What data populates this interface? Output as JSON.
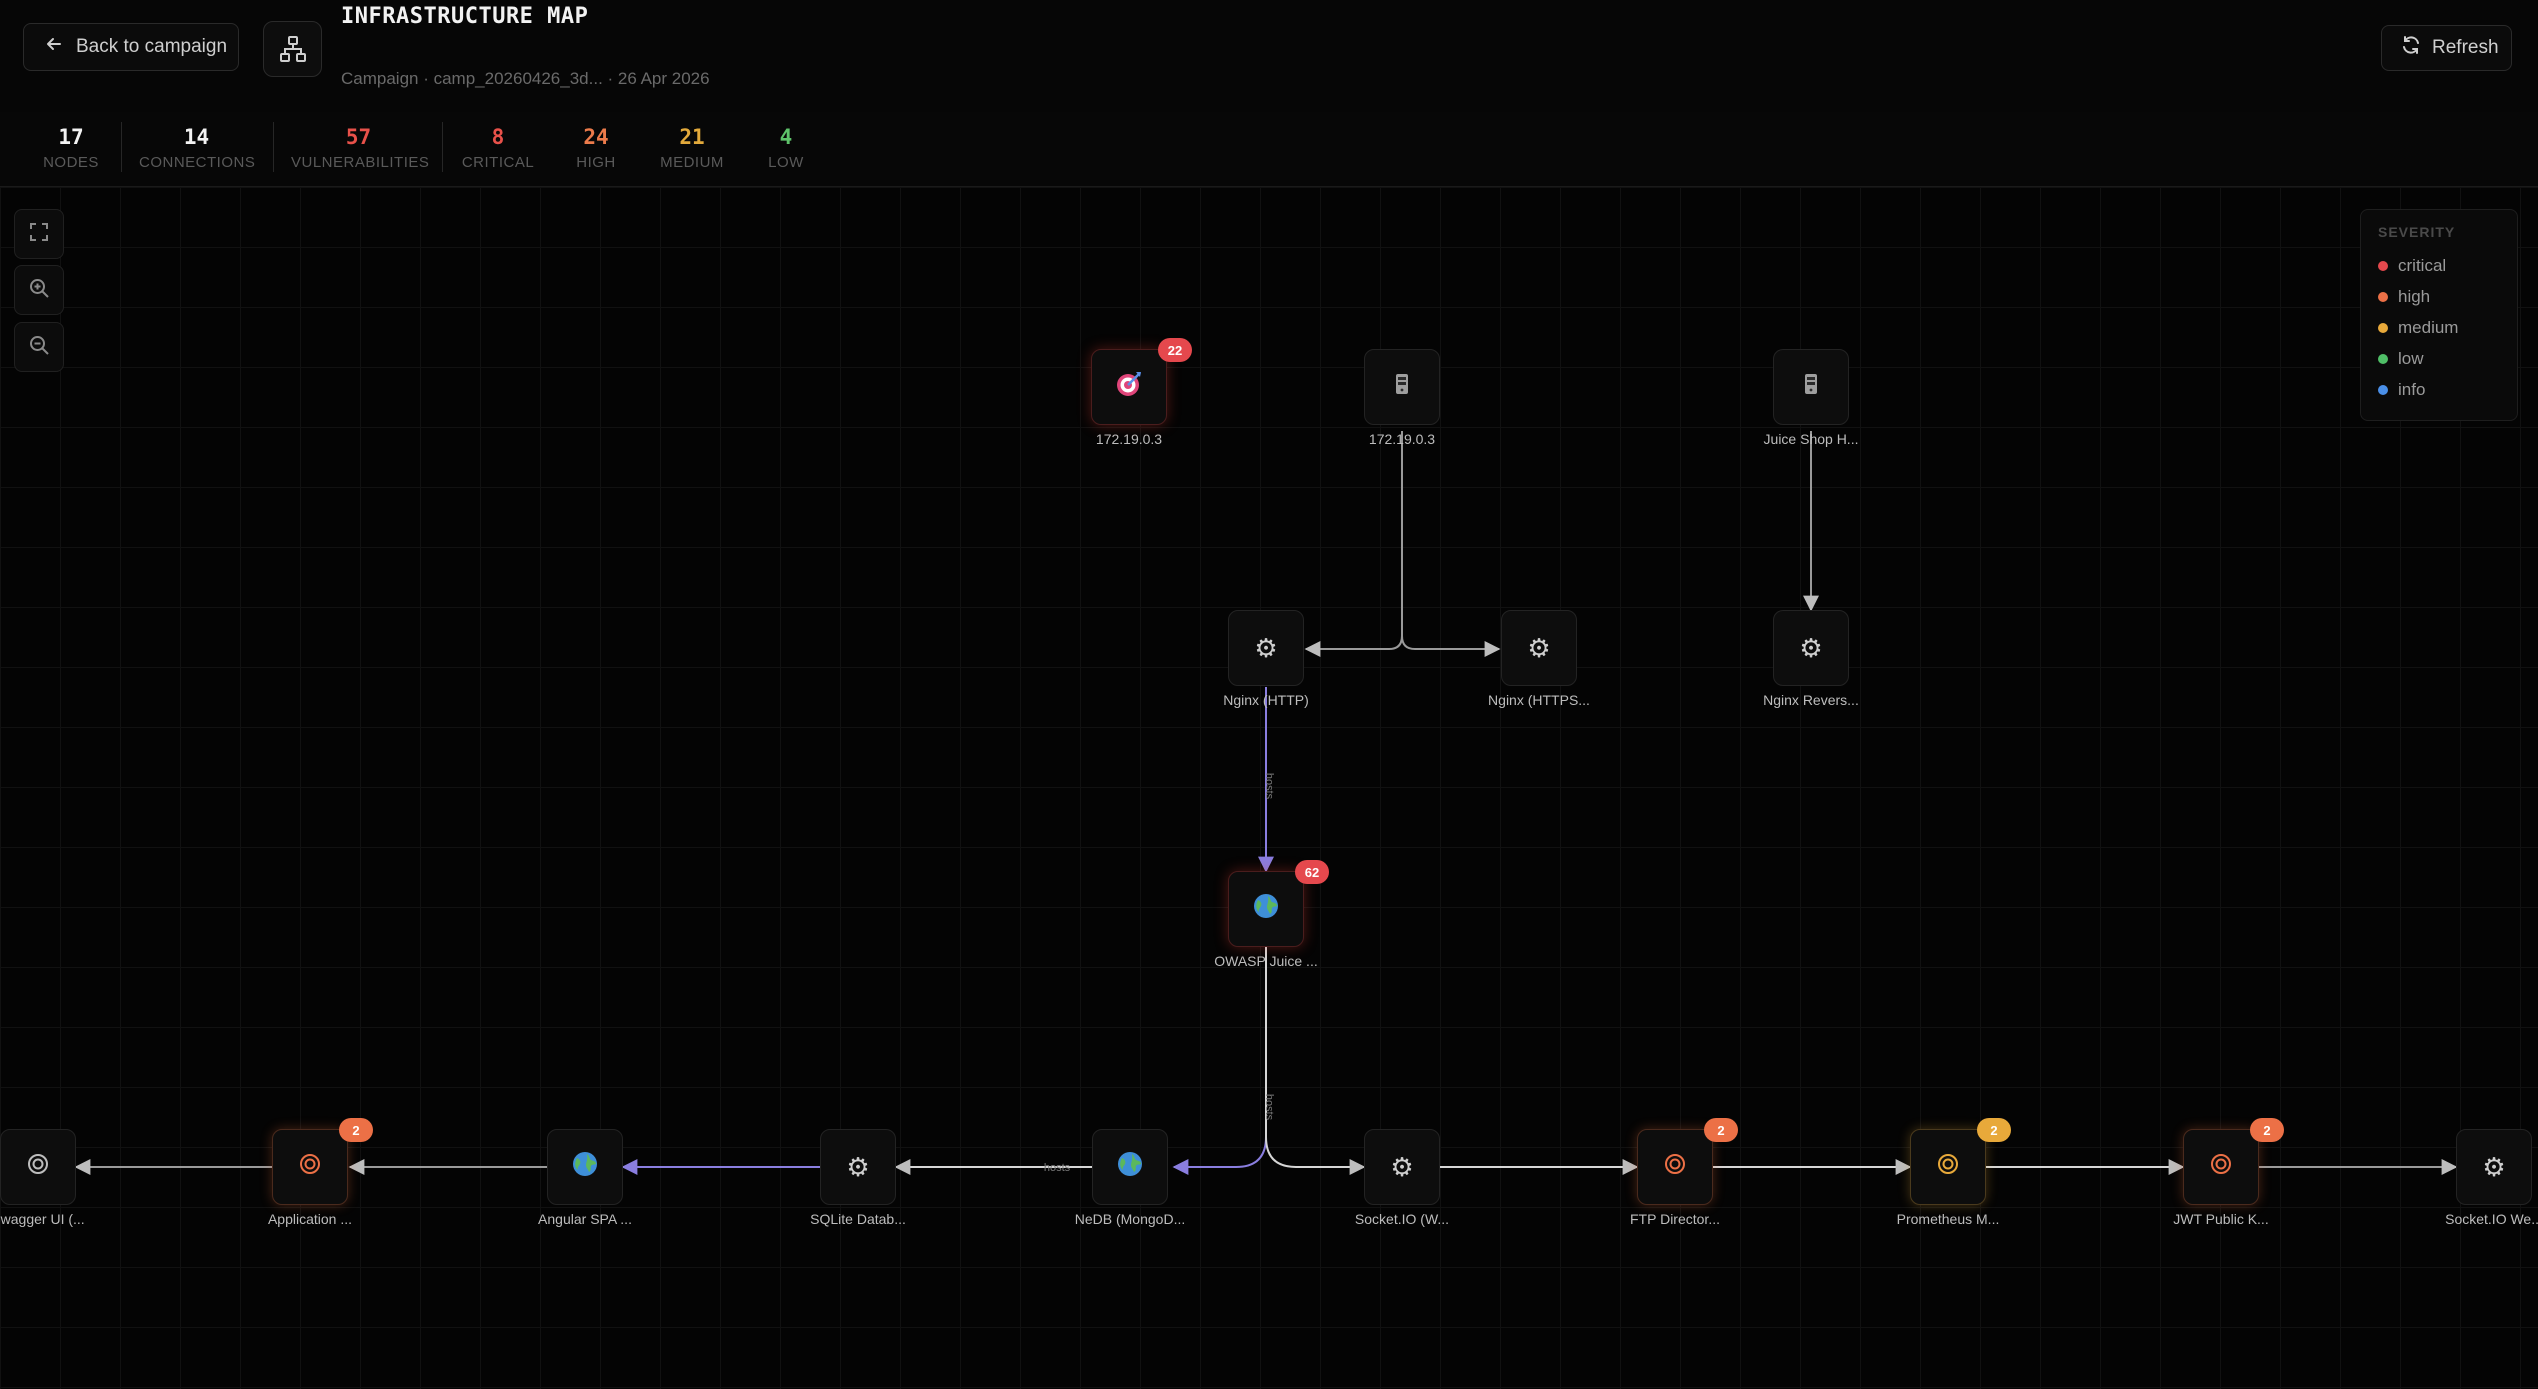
{
  "header": {
    "back_label": "Back to campaign",
    "title": "INFRASTRUCTURE MAP",
    "subtitle": "Campaign · camp_20260426_3d... · 26 Apr 2026",
    "refresh_label": "Refresh"
  },
  "stats": [
    {
      "value": "17",
      "label": "NODES",
      "color": "#f2f2f2"
    },
    {
      "value": "14",
      "label": "CONNECTIONS",
      "color": "#f2f2f2"
    },
    {
      "value": "57",
      "label": "VULNERABILITIES",
      "color": "#e8514a"
    },
    {
      "value": "8",
      "label": "CRITICAL",
      "color": "#e8514a"
    },
    {
      "value": "24",
      "label": "HIGH",
      "color": "#ec7b4b"
    },
    {
      "value": "21",
      "label": "MEDIUM",
      "color": "#e2a93b"
    },
    {
      "value": "4",
      "label": "LOW",
      "color": "#5ec26a"
    }
  ],
  "colors": {
    "critical": "#e5484d",
    "high": "#ec7046",
    "medium": "#e8a93a",
    "low": "#4fbf67",
    "info": "#4a8fe8",
    "edge": "#9a9a9a",
    "edge_accent": "#8a7ee0"
  },
  "legend": {
    "title": "SEVERITY",
    "items": [
      {
        "label": "critical",
        "color": "#e5484d"
      },
      {
        "label": "high",
        "color": "#ec7046"
      },
      {
        "label": "medium",
        "color": "#e8a93a"
      },
      {
        "label": "low",
        "color": "#4fbf67"
      },
      {
        "label": "info",
        "color": "#4a8fe8"
      }
    ]
  },
  "edge_labels": {
    "serves": "hosts"
  },
  "nodes": [
    {
      "id": "target",
      "label": "172.19.0.3",
      "icon": "target-icon",
      "badge": "22",
      "severity": "critical"
    },
    {
      "id": "host1",
      "label": "172.19.0.3",
      "icon": "server-icon",
      "badge": "",
      "severity": ""
    },
    {
      "id": "host2",
      "label": "Juice Shop H...",
      "icon": "server-icon",
      "badge": "",
      "severity": ""
    },
    {
      "id": "nginx_http",
      "label": "Nginx (HTTP)",
      "icon": "gear-icon",
      "badge": "",
      "severity": ""
    },
    {
      "id": "nginx_https",
      "label": "Nginx (HTTPS...",
      "icon": "gear-icon",
      "badge": "",
      "severity": ""
    },
    {
      "id": "nginx_rev",
      "label": "Nginx Revers...",
      "icon": "gear-icon",
      "badge": "",
      "severity": ""
    },
    {
      "id": "juice",
      "label": "OWASP Juice ...",
      "icon": "globe-icon",
      "badge": "62",
      "severity": "critical"
    },
    {
      "id": "swagger",
      "label": "Swagger UI (...",
      "icon": "endpoint-icon",
      "badge": "",
      "severity": ""
    },
    {
      "id": "application",
      "label": "Application ...",
      "icon": "endpoint-icon",
      "badge": "2",
      "severity": "high"
    },
    {
      "id": "angular",
      "label": "Angular SPA ...",
      "icon": "globe-icon",
      "badge": "",
      "severity": ""
    },
    {
      "id": "sqlite",
      "label": "SQLite Datab...",
      "icon": "gear-icon",
      "badge": "",
      "severity": ""
    },
    {
      "id": "nedb",
      "label": "NeDB (MongoD...",
      "icon": "globe-icon",
      "badge": "",
      "severity": ""
    },
    {
      "id": "socketio",
      "label": "Socket.IO (W...",
      "icon": "gear-icon",
      "badge": "",
      "severity": ""
    },
    {
      "id": "ftp",
      "label": "FTP Director...",
      "icon": "endpoint-icon",
      "badge": "2",
      "severity": "high"
    },
    {
      "id": "prometheus",
      "label": "Prometheus M...",
      "icon": "endpoint-icon",
      "badge": "2",
      "severity": "medium"
    },
    {
      "id": "jwt",
      "label": "JWT Public K...",
      "icon": "endpoint-icon",
      "badge": "2",
      "severity": "high"
    },
    {
      "id": "socketio_we",
      "label": "Socket.IO We...",
      "icon": "gear-icon",
      "badge": "",
      "severity": ""
    }
  ]
}
